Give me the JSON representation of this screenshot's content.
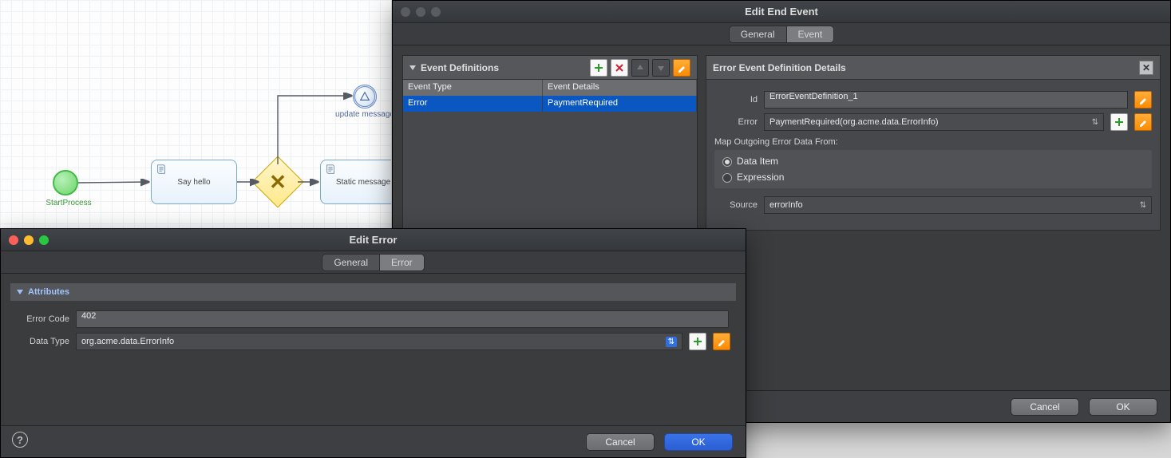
{
  "canvas": {
    "start_label": "StartProcess",
    "task1_label": "Say hello",
    "task2_label": "Static message",
    "intermediate_label": "update message"
  },
  "win_event": {
    "title": "Edit End Event",
    "tabs": {
      "general": "General",
      "event": "Event"
    },
    "defs": {
      "header": "Event Definitions",
      "col_type": "Event Type",
      "col_details": "Event Details",
      "rows": [
        {
          "type": "Error",
          "details": "PaymentRequired"
        }
      ]
    },
    "details": {
      "header": "Error Event Definition Details",
      "id_label": "Id",
      "id_value": "ErrorEventDefinition_1",
      "error_label": "Error",
      "error_value": "PaymentRequired(org.acme.data.ErrorInfo)",
      "map_header": "Map Outgoing Error Data From:",
      "radio_data_item": "Data Item",
      "radio_expression": "Expression",
      "source_label": "Source",
      "source_value": "errorInfo"
    },
    "buttons": {
      "cancel": "Cancel",
      "ok": "OK"
    }
  },
  "win_error": {
    "title": "Edit Error",
    "tabs": {
      "general": "General",
      "error": "Error"
    },
    "section": "Attributes",
    "error_code_label": "Error Code",
    "error_code_value": "402",
    "data_type_label": "Data Type",
    "data_type_value": "org.acme.data.ErrorInfo",
    "buttons": {
      "cancel": "Cancel",
      "ok": "OK"
    }
  }
}
